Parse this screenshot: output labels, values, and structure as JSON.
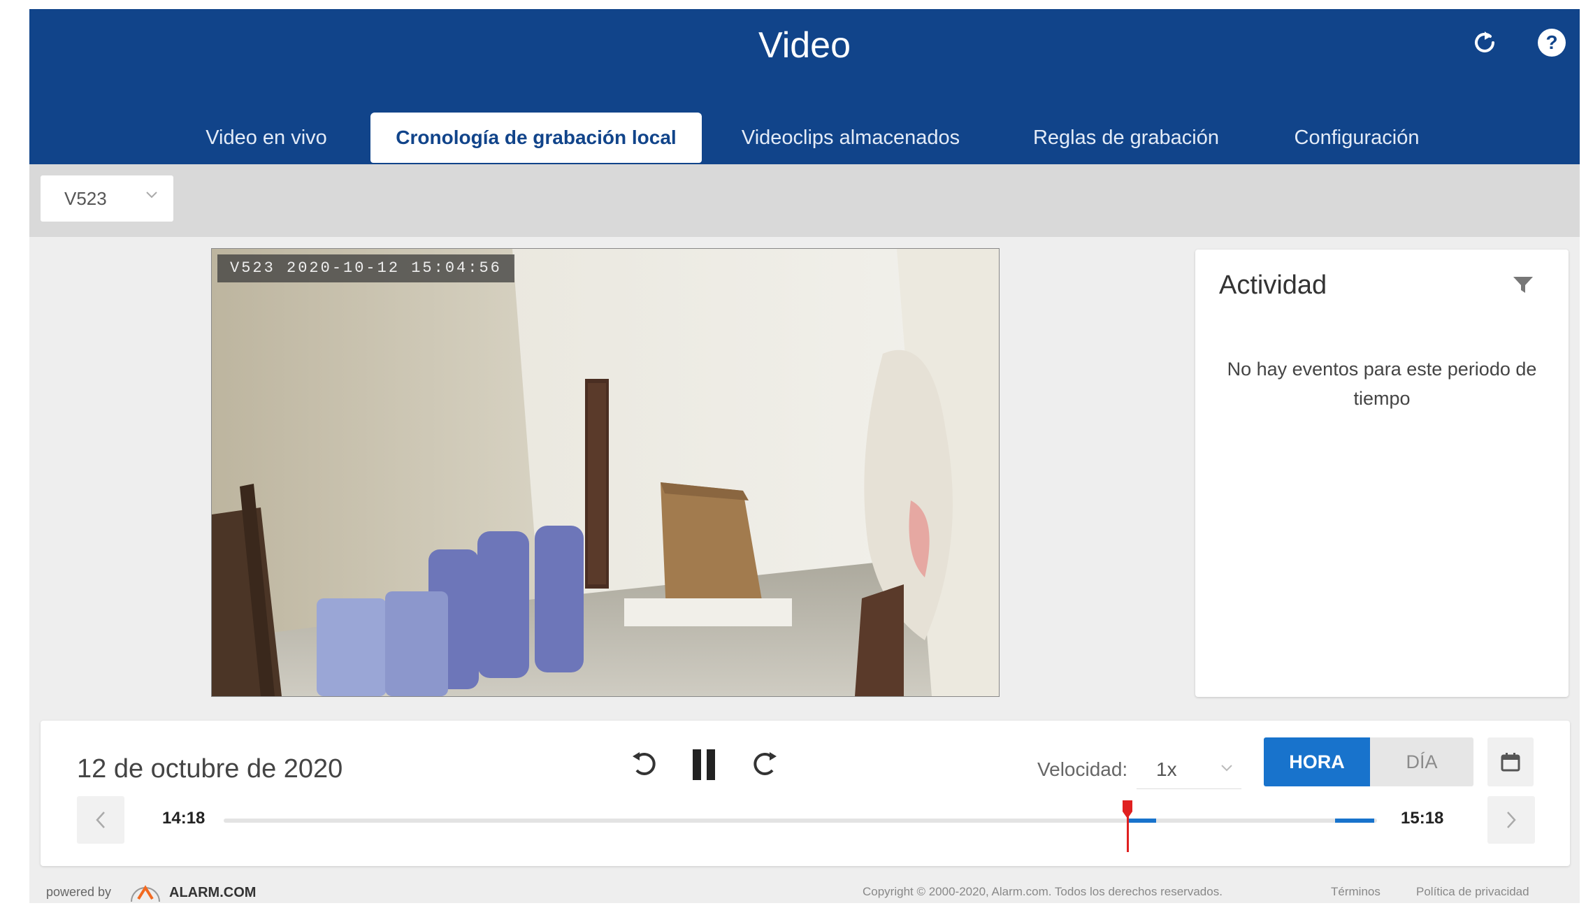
{
  "header": {
    "title": "Video",
    "refresh_icon": "refresh-icon",
    "help_icon": "help-icon"
  },
  "tabs": [
    {
      "label": "Video en vivo",
      "active": false
    },
    {
      "label": "Cronología de grabación local",
      "active": true
    },
    {
      "label": "Videoclips almacenados",
      "active": false
    },
    {
      "label": "Reglas de grabación",
      "active": false
    },
    {
      "label": "Configuración",
      "active": false
    }
  ],
  "camera_select": {
    "value": "V523"
  },
  "video": {
    "overlay": "V523 2020-10-12 15:04:56"
  },
  "activity": {
    "title": "Actividad",
    "empty_message": "No hay eventos para este periodo de tiempo"
  },
  "controls": {
    "date": "12 de octubre de 2020",
    "speed_label": "Velocidad:",
    "speed_value": "1x",
    "toggle_hora": "HORA",
    "toggle_dia": "DÍA",
    "time_start": "14:18",
    "time_end": "15:18"
  },
  "footer": {
    "powered_by": "powered by",
    "logo_text": "ALARM.COM",
    "copyright": "Copyright © 2000-2020, Alarm.com. Todos los derechos reservados.",
    "terms": "Términos",
    "privacy": "Política de privacidad"
  },
  "colors": {
    "header_bg": "#11448a",
    "accent": "#1873cc",
    "playhead": "#e02020"
  }
}
